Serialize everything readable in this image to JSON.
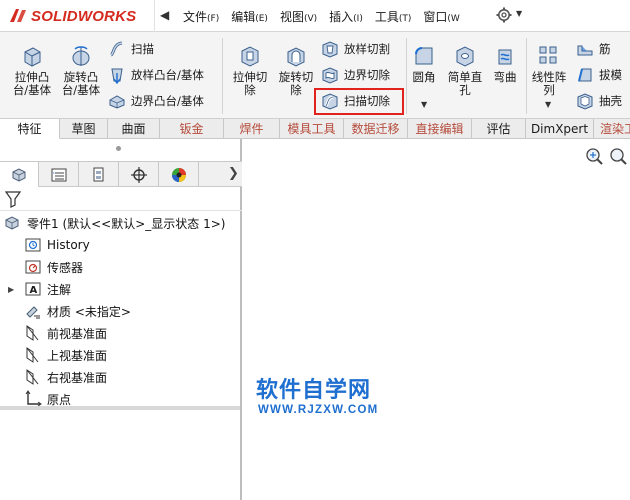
{
  "app": {
    "brand": "SOLIDWORKS"
  },
  "menu": {
    "items": [
      {
        "label": "文件",
        "key": "(F)"
      },
      {
        "label": "编辑",
        "key": "(E)"
      },
      {
        "label": "视图",
        "key": "(V)"
      },
      {
        "label": "插入",
        "key": "(I)"
      },
      {
        "label": "工具",
        "key": "(T)"
      },
      {
        "label": "窗口",
        "key": "(W"
      }
    ]
  },
  "ribbon": {
    "extrude_boss": "拉伸凸\n台/基体",
    "revolve_boss": "旋转凸\n台/基体",
    "sweep": "扫描",
    "loft_boss": "放样凸台/基体",
    "boundary_boss": "边界凸台/基体",
    "extrude_cut": "拉伸切\n除",
    "revolve_cut": "旋转切\n除",
    "loft_cut": "放样切割",
    "boundary_cut": "边界切除",
    "sweep_cut": "扫描切除",
    "fillet": "圆角",
    "simple_hole": "简单直\n孔",
    "wrap": "弯曲",
    "linear_pattern": "线性阵\n列",
    "rib": "筋",
    "draft": "拔模",
    "shell": "抽壳"
  },
  "tabs": [
    "特征",
    "草图",
    "曲面",
    "钣金",
    "焊件",
    "模具工具",
    "数据迁移",
    "直接编辑",
    "评估",
    "DimXpert",
    "渲染工"
  ],
  "tree": {
    "part": "零件1  (默认<<默认>_显示状态 1>)",
    "history": "History",
    "sensors": "传感器",
    "annotations": "注解",
    "material": "材质 <未指定>",
    "front_plane": "前视基准面",
    "top_plane": "上视基准面",
    "right_plane": "右视基准面",
    "origin": "原点"
  },
  "watermark": {
    "title": "软件自学网",
    "url": "WWW.RJZXW.COM"
  },
  "colors": {
    "brand_red": "#d52b1e",
    "highlight_red": "#e0231c",
    "watermark_blue": "#1f6fd0"
  }
}
